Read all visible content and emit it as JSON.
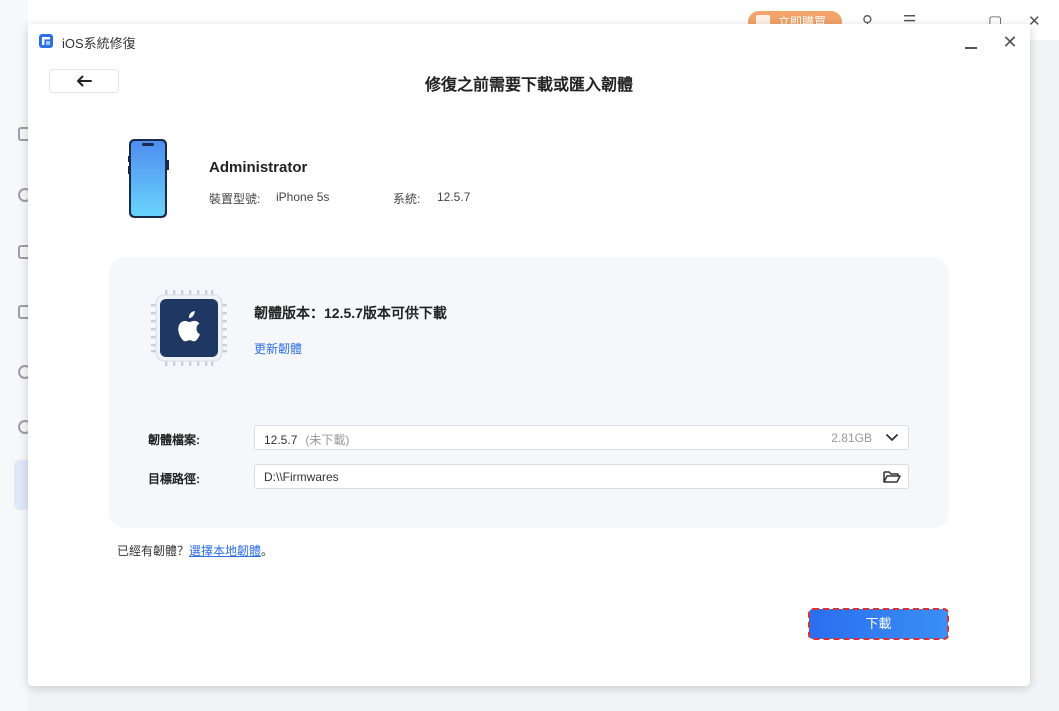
{
  "background_app": {
    "buy_label": "立即購買"
  },
  "window": {
    "title": "iOS系統修復",
    "page_title": "修復之前需要下載或匯入韌體"
  },
  "device": {
    "name": "Administrator",
    "model_label": "裝置型號:",
    "model_value": "iPhone 5s",
    "system_label": "系統:",
    "system_value": "12.5.7"
  },
  "firmware": {
    "version_text": "韌體版本：12.5.7版本可供下載",
    "update_link": "更新韌體",
    "file_label": "韌體檔案:",
    "file_value": "12.5.7",
    "file_status": "(未下載)",
    "file_size": "2.81GB",
    "path_label": "目標路徑:",
    "path_value": "D:\\\\Firmwares"
  },
  "footer": {
    "already_text": "已經有韌體？",
    "select_local_link": "選擇本地韌體",
    "period": "。",
    "download_button": "下載"
  },
  "colors": {
    "accent": "#2f6fe4",
    "button": "#2b6ef0",
    "highlight_border": "#e03131"
  }
}
